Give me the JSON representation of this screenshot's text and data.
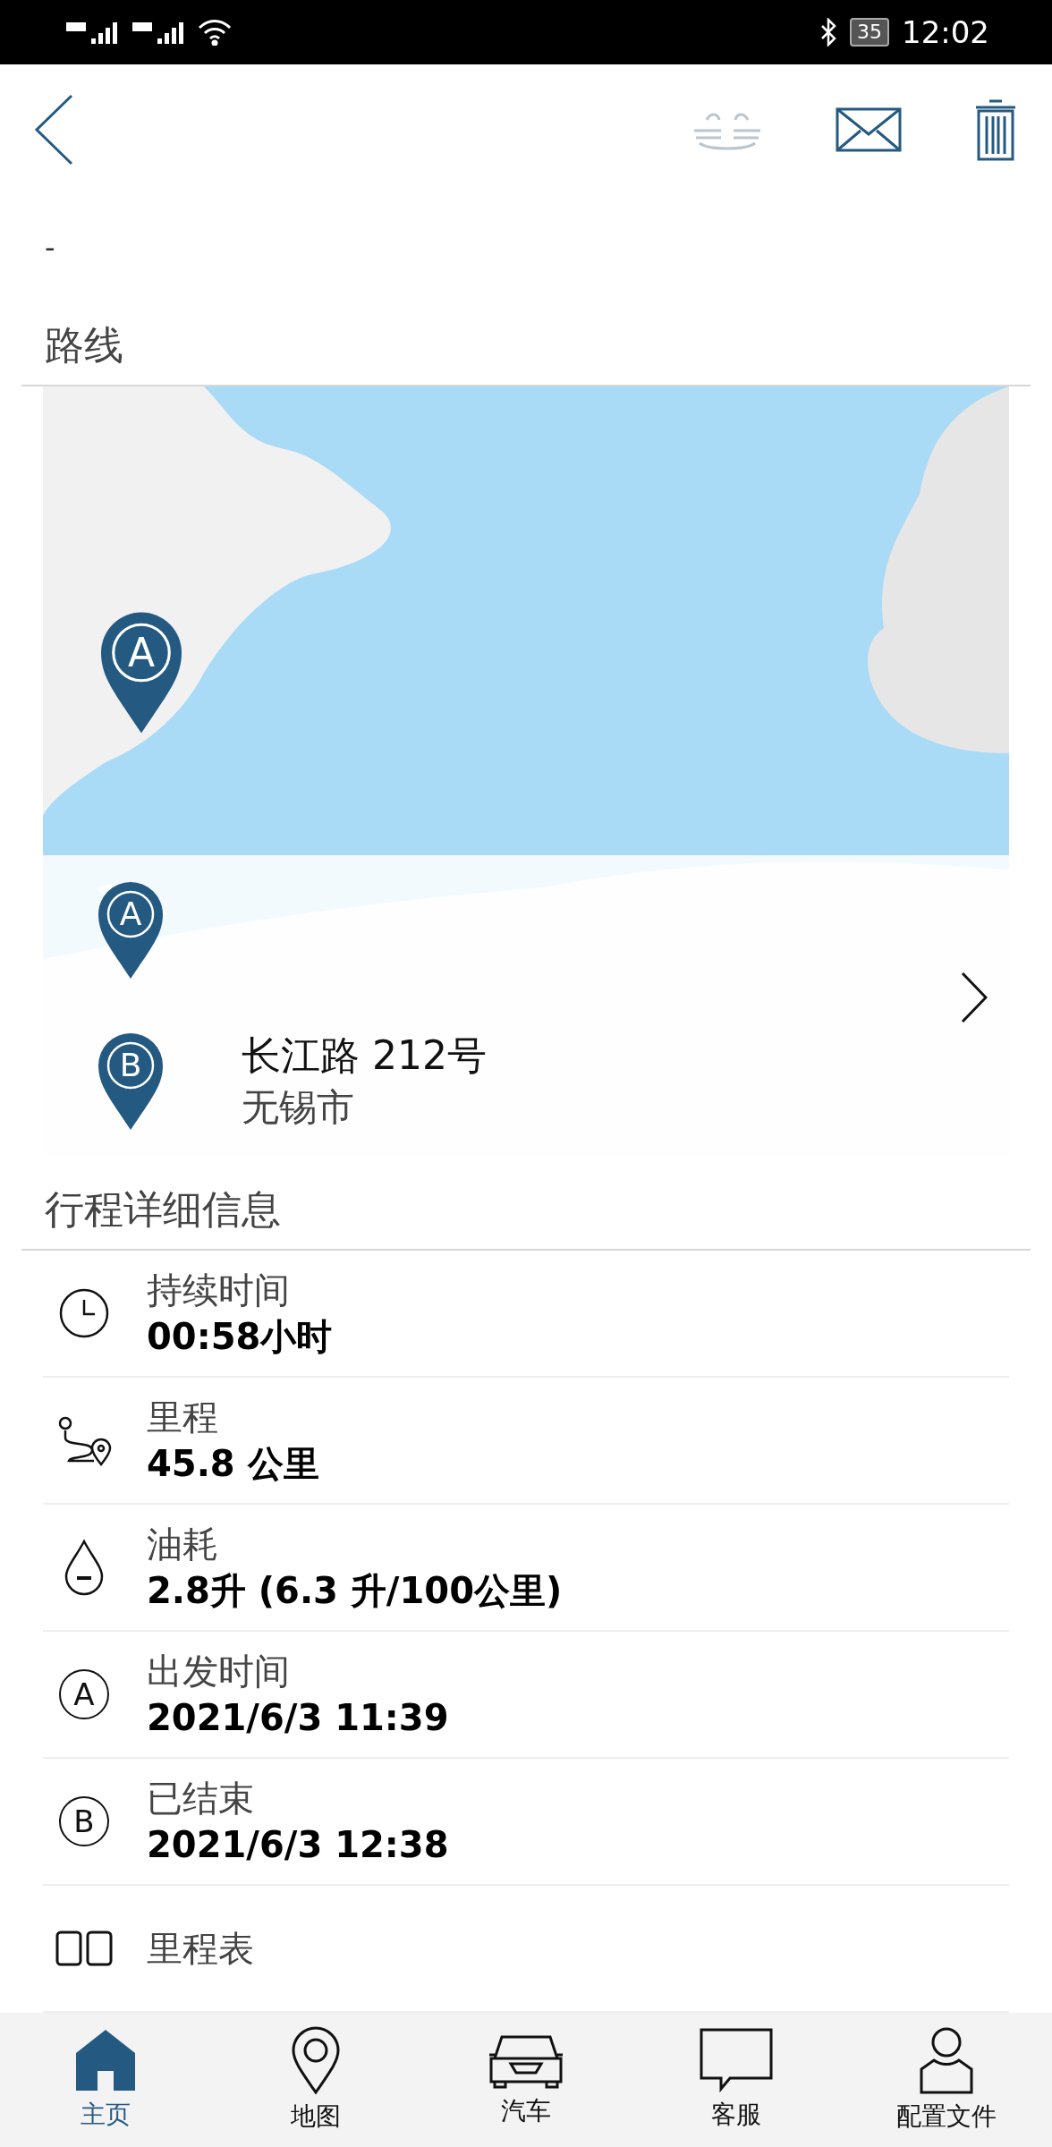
{
  "status_bar": {
    "battery": "35",
    "time": "12:02"
  },
  "header": {
    "actions": [
      {
        "kind": "share",
        "disabled": true
      },
      {
        "kind": "mail",
        "disabled": false
      },
      {
        "kind": "delete",
        "disabled": false
      }
    ]
  },
  "top_value": "-",
  "route": {
    "title": "路线",
    "map_marker": "A",
    "start": {
      "marker": "A"
    },
    "end": {
      "marker": "B",
      "street": "长江路 212号",
      "city": "无锡市"
    }
  },
  "details": {
    "title": "行程详细信息",
    "rows": [
      {
        "kind": "clock",
        "label": "持续时间",
        "value": "00:58小时"
      },
      {
        "kind": "route",
        "label": "里程",
        "value": "45.8 公里"
      },
      {
        "kind": "fuel",
        "label": "油耗",
        "value": "2.8升 (6.3 升/100公里)"
      },
      {
        "kind": "letter",
        "letter": "A",
        "label": "出发时间",
        "value": "2021/6/3 11:39"
      },
      {
        "kind": "letter",
        "letter": "B",
        "label": "已结束",
        "value": "2021/6/3 12:38"
      },
      {
        "kind": "odometer",
        "label": "里程表"
      }
    ]
  },
  "nav": [
    {
      "kind": "home",
      "label": "主页",
      "selected": true
    },
    {
      "kind": "map",
      "label": "地图",
      "selected": false
    },
    {
      "kind": "car",
      "label": "汽车",
      "selected": false
    },
    {
      "kind": "service",
      "label": "客服",
      "selected": false
    },
    {
      "kind": "profile",
      "label": "配置文件",
      "selected": false
    }
  ]
}
